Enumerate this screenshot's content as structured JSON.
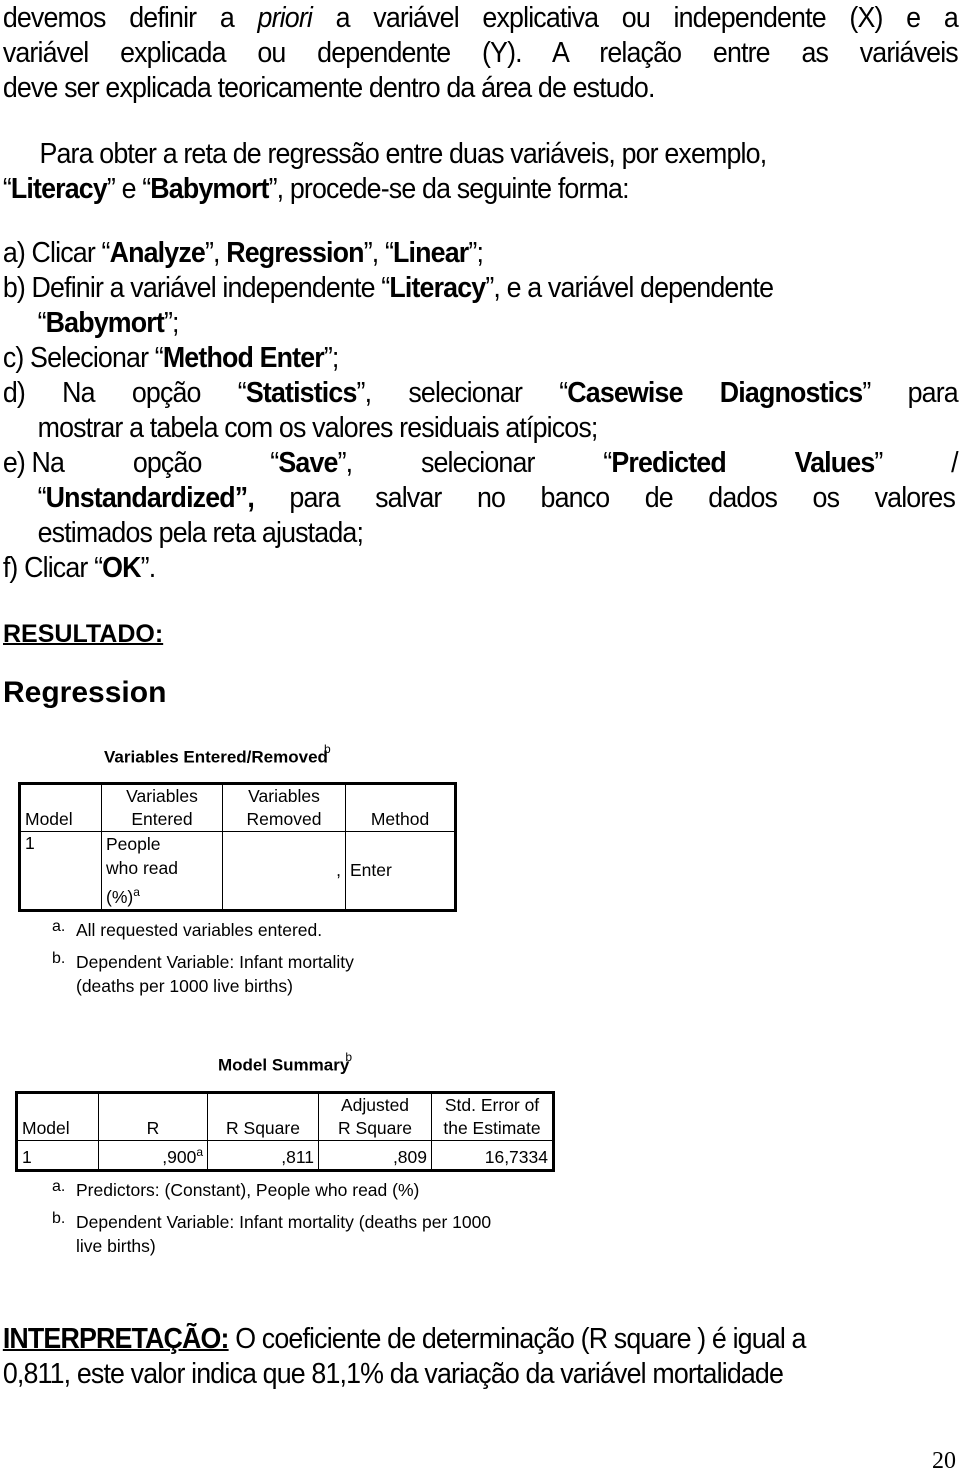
{
  "intro": {
    "line1_a": "devemos definir a ",
    "line1_italic": "priori",
    "line1_b": " a variável explicativa ou independente (X) e a",
    "line2": "variável explicada ou dependente (Y). A relação entre as variáveis",
    "line3": "deve ser explicada teoricamente dentro da área de estudo."
  },
  "procedure": {
    "line1": "Para obter a reta de regressão entre duas variáveis, por exemplo,",
    "line2_q1": "“",
    "line2_var1": "Literacy",
    "line2_mid": "” e “",
    "line2_var2": "Babymort",
    "line2_end": "”, procede-se da seguinte forma:"
  },
  "steps": [
    {
      "label": "a) Clicar “",
      "b1": "Analyze",
      "t1": "”, ",
      "b2": "Regression",
      "t2": "”, “",
      "b3": "Linear",
      "t3": "”;"
    },
    {
      "label": "b) Definir a variável independente “",
      "b1": "Literacy",
      "t1": "”, e a variável dependente",
      "cont_q": "“",
      "cont_b": "Babymort",
      "cont_end": "”;"
    },
    {
      "label": "c) Selecionar “",
      "b1": "Method Enter",
      "t1": "”;"
    },
    {
      "label": "d) Na opção “",
      "b1": "Statistics",
      "t1": "”, selecionar “",
      "b2": "Casewise Diagnostics",
      "t2": "” para",
      "cont": "mostrar a tabela com os valores residuais atípicos;"
    },
    {
      "label_a": "e) Na",
      "label_b": "opção",
      "q1": "“",
      "b1": "Save",
      "t1": "”,",
      "w1": "selecionar",
      "q2": "“",
      "b2": "Predicted",
      "b3": "Values",
      "t3": "”",
      "slash": "/",
      "cont_q": "“",
      "cont_b": "Unstandardized",
      "cont_comma": "”,",
      "cont_rest": " para salvar no banco de dados os valores",
      "cont2": "estimados pela reta ajustada;"
    },
    {
      "label": "f) Clicar “",
      "b1": "OK",
      "t1": "”."
    }
  ],
  "result_heading": "RESULTADO:",
  "regression_title": "Regression",
  "table1": {
    "title": "Variables Entered/Removed",
    "title_sup": "b",
    "headers": [
      "Model",
      "Variables Entered",
      "Variables Removed",
      "Method"
    ],
    "header_lines": [
      [
        "",
        "Model"
      ],
      [
        "Variables",
        "Entered"
      ],
      [
        "Variables",
        "Removed"
      ],
      [
        "",
        "Method"
      ]
    ],
    "rows": [
      {
        "model": "1",
        "entered_lines": [
          "People",
          "who read",
          "(%)"
        ],
        "entered_sup": "a",
        "removed": ",",
        "method": "Enter"
      }
    ],
    "footnotes": [
      {
        "mark": "a.",
        "text": "All requested variables entered."
      },
      {
        "mark": "b.",
        "text": "Dependent Variable: Infant mortality",
        "text2": "(deaths per 1000 live births)"
      }
    ]
  },
  "table2": {
    "title": "Model Summary",
    "title_sup": "b",
    "header_lines": [
      [
        "",
        "Model"
      ],
      [
        "",
        "R"
      ],
      [
        "",
        "R Square"
      ],
      [
        "Adjusted",
        "R Square"
      ],
      [
        "Std. Error of",
        "the Estimate"
      ]
    ],
    "rows": [
      {
        "model": "1",
        "r": ",900",
        "r_sup": "a",
        "r_square": ",811",
        "adj_r_square": ",809",
        "std_error": "16,7334"
      }
    ],
    "footnotes": [
      {
        "mark": "a.",
        "text": "Predictors: (Constant), People who read (%)"
      },
      {
        "mark": "b.",
        "text": "Dependent Variable: Infant mortality (deaths per 1000",
        "text2": "live births)"
      }
    ]
  },
  "interpretation": {
    "label": "INTERPRETAÇÃO:",
    "line1": " O coeficiente de determinação (R square ) é igual a",
    "line2": "0,811, este valor indica que 81,1% da variação da variável mortalidade"
  },
  "page_number": "20"
}
